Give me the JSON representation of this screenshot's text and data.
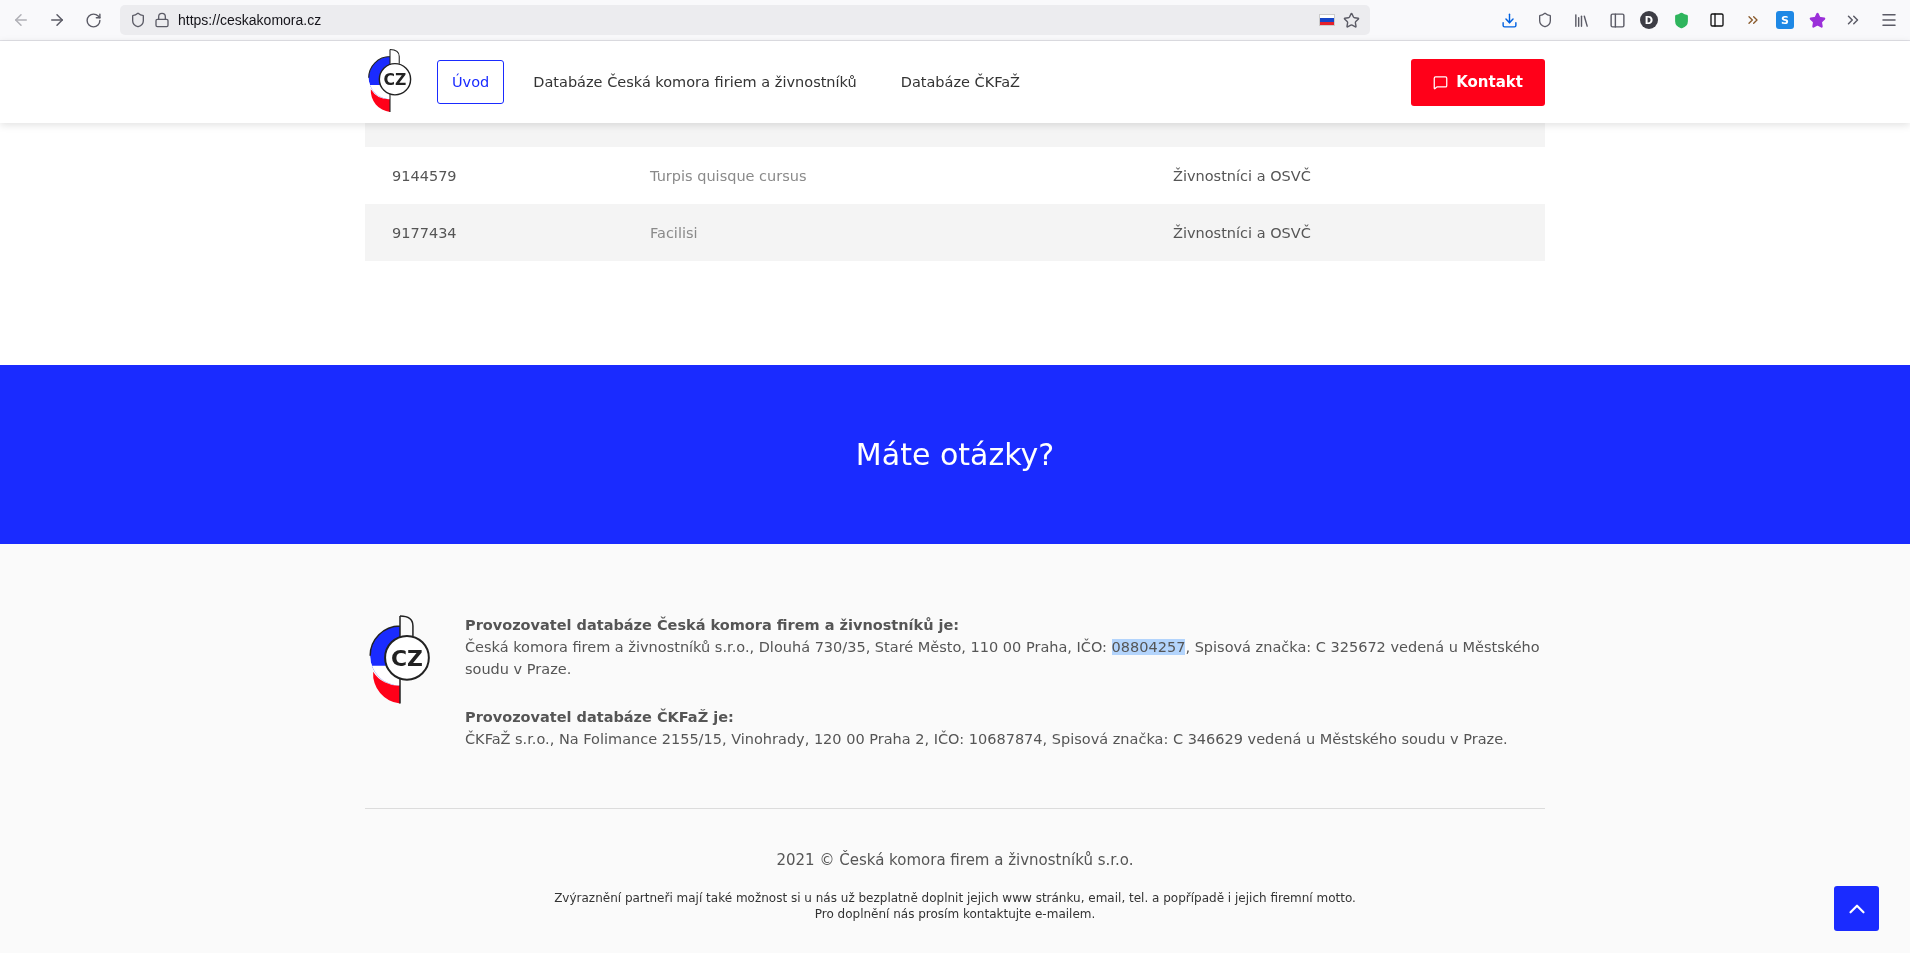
{
  "browser": {
    "url": "https://ceskakomora.cz",
    "profile_initial": "D",
    "extension_letter": "S"
  },
  "nav": {
    "items": [
      {
        "label": "Úvod",
        "selected": true
      },
      {
        "label": "Databáze Česká komora firiem a živnostníků",
        "selected": false
      },
      {
        "label": "Databáze ČKFaŽ",
        "selected": false
      }
    ],
    "logo_text": "CZ",
    "contact_button": "Kontakt"
  },
  "table": {
    "rows": [
      {
        "column_1": "9144579",
        "column_2": "Turpis quisque cursus",
        "column_3": "Živnostníci a OSVČ"
      },
      {
        "column_1": "9177434",
        "column_2": "Facilisi",
        "column_3": "Živnostníci a OSVČ"
      }
    ]
  },
  "banner": {
    "title": "Máte otázky?"
  },
  "footer": {
    "logo_text": "CZ",
    "operators": [
      {
        "heading": "Provozovatel databáze Česká komora firem a živnostníků je:",
        "parts": [
          {
            "text": "Česká komora firem a živnostníků s.r.o., Dlouhá 730/35, Staré Město, 110 00 Praha, IČO: ",
            "highlighted": false
          },
          {
            "text": "08804257",
            "highlighted": true
          },
          {
            "text": ", Spisová značka: C 325672 vedená u Městského soudu v Praze.",
            "highlighted": false
          }
        ]
      },
      {
        "heading": "Provozovatel databáze ČKFaŽ je:",
        "parts": [
          {
            "text": "ČKFaŽ s.r.o., Na Folimance 2155/15, Vinohrady, 120 00 Praha 2, IČO: 10687874, Spisová značka: C 346629 vedená u Městského soudu v Praze.",
            "highlighted": false
          }
        ]
      }
    ],
    "copyright": "2021 © Česká komora firem a živnostníků s.r.o.",
    "notes": [
      "Zvýraznění partneři mají také možnost si u nás už bezplatně doplnit jejich www stránku, email, tel. a popřípadě i jejich firemní motto.",
      "Pro doplnění nás prosím kontaktujte e-mailem."
    ]
  }
}
